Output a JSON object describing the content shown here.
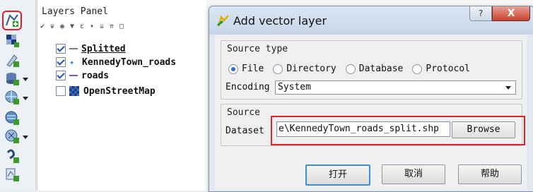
{
  "layers_panel": {
    "title": "Layers Panel",
    "layers": [
      {
        "name": "Splitted",
        "checked": true,
        "symbol": "gray-line"
      },
      {
        "name": "KennedyTown_roads",
        "checked": true,
        "symbol": "star"
      },
      {
        "name": "roads",
        "checked": true,
        "symbol": "purple-line"
      },
      {
        "name": "OpenStreetMap",
        "checked": false,
        "symbol": "raster"
      }
    ]
  },
  "toolbar": {
    "icons": [
      "add-vector-layer-icon",
      "add-raster-layer-icon",
      "add-delimited-text-icon",
      "add-database-layer-icon",
      "add-wms-layer-icon",
      "add-wcs-layer-icon",
      "add-wfs-layer-icon",
      "add-virtual-layer-icon",
      "add-new-layer-icon"
    ]
  },
  "dialog": {
    "title": "Add vector layer",
    "help_symbol": "?",
    "close_symbol": "X",
    "source_type": {
      "heading": "Source type",
      "options": [
        "File",
        "Directory",
        "Database",
        "Protocol"
      ],
      "selected": "File",
      "encoding_label": "Encoding",
      "encoding_value": "System"
    },
    "source": {
      "heading": "Source",
      "dataset_label": "Dataset",
      "dataset_value": "e\\KennedyTown_roads_split.shp",
      "browse_label": "Browse"
    },
    "buttons": {
      "open": "打开",
      "cancel": "取消",
      "help": "帮助"
    }
  },
  "colors": {
    "highlight": "#e0222a",
    "accent": "#2d6bd6"
  }
}
